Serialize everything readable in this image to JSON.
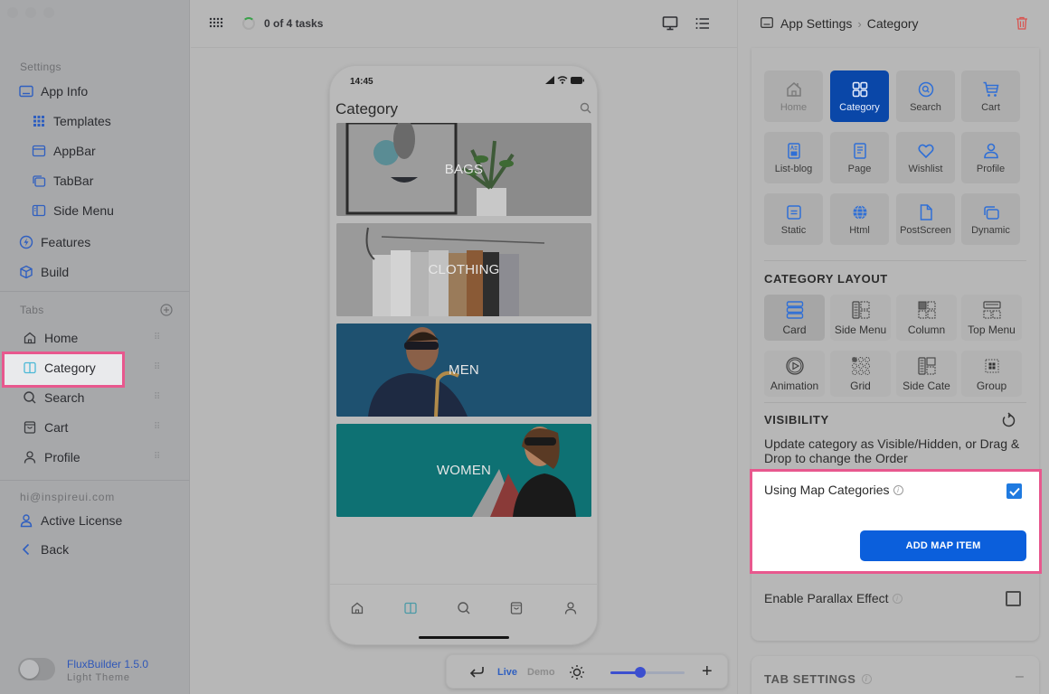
{
  "colors": {
    "accent": "#0b5fdc",
    "highlight": "#e8588e",
    "link": "#2f57b8",
    "danger": "#d9534f"
  },
  "sidebar": {
    "settings_label": "Settings",
    "settings_items": [
      {
        "label": "App Info",
        "icon": "app-info-icon"
      },
      {
        "label": "Templates",
        "icon": "templates-icon"
      },
      {
        "label": "AppBar",
        "icon": "appbar-icon"
      },
      {
        "label": "TabBar",
        "icon": "tabbar-icon"
      },
      {
        "label": "Side Menu",
        "icon": "side-menu-icon"
      },
      {
        "label": "Features",
        "icon": "features-icon"
      },
      {
        "label": "Build",
        "icon": "build-icon"
      }
    ],
    "tabs_label": "Tabs",
    "tabs": [
      {
        "label": "Home",
        "icon": "home-icon"
      },
      {
        "label": "Category",
        "icon": "category-icon",
        "active": true
      },
      {
        "label": "Search",
        "icon": "search-icon"
      },
      {
        "label": "Cart",
        "icon": "cart-icon"
      },
      {
        "label": "Profile",
        "icon": "profile-icon"
      }
    ],
    "email": "hi@inspireui.com",
    "active_license": "Active License",
    "back": "Back",
    "version": "FluxBuilder 1.5.0",
    "theme": "Light Theme",
    "theme_toggle_on": false
  },
  "topbar": {
    "tasks": "0 of 4 tasks"
  },
  "phone": {
    "time": "14:45",
    "title": "Category",
    "categories": [
      {
        "label": "BAGS"
      },
      {
        "label": "CLOTHING"
      },
      {
        "label": "MEN"
      },
      {
        "label": "WOMEN"
      }
    ],
    "tabbar": [
      "home",
      "category",
      "search",
      "cart",
      "profile"
    ],
    "active_tab": "category"
  },
  "bottombar": {
    "live": "Live",
    "demo": "Demo",
    "zoom_level": 0.4
  },
  "right_panel": {
    "breadcrumb": [
      "App Settings",
      "Category"
    ],
    "screens": [
      {
        "label": "Home",
        "icon": "home-icon",
        "state": "muted"
      },
      {
        "label": "Category",
        "icon": "category-icon",
        "state": "active"
      },
      {
        "label": "Search",
        "icon": "search-icon"
      },
      {
        "label": "Cart",
        "icon": "cart-icon"
      },
      {
        "label": "List-blog",
        "icon": "list-blog-icon"
      },
      {
        "label": "Page",
        "icon": "page-icon"
      },
      {
        "label": "Wishlist",
        "icon": "heart-icon"
      },
      {
        "label": "Profile",
        "icon": "profile-icon"
      },
      {
        "label": "Static",
        "icon": "static-icon"
      },
      {
        "label": "Html",
        "icon": "globe-icon"
      },
      {
        "label": "PostScreen",
        "icon": "post-screen-icon"
      },
      {
        "label": "Dynamic",
        "icon": "dynamic-icon"
      }
    ],
    "category_layout_title": "CATEGORY LAYOUT",
    "layouts": [
      {
        "label": "Card",
        "active": true
      },
      {
        "label": "Side Menu"
      },
      {
        "label": "Column"
      },
      {
        "label": "Top Menu"
      },
      {
        "label": "Animation"
      },
      {
        "label": "Grid"
      },
      {
        "label": "Side Cate"
      },
      {
        "label": "Group"
      }
    ],
    "visibility_title": "VISIBILITY",
    "visibility_desc": "Update category as Visible/Hidden, or Drag & Drop to change the Order",
    "using_map_label": "Using Map Categories",
    "using_map_checked": true,
    "add_map_button": "ADD MAP ITEM",
    "parallax_label": "Enable Parallax Effect",
    "parallax_checked": false,
    "tab_settings_title": "TAB SETTINGS",
    "info_glyph": "i",
    "minus_glyph": "–"
  }
}
